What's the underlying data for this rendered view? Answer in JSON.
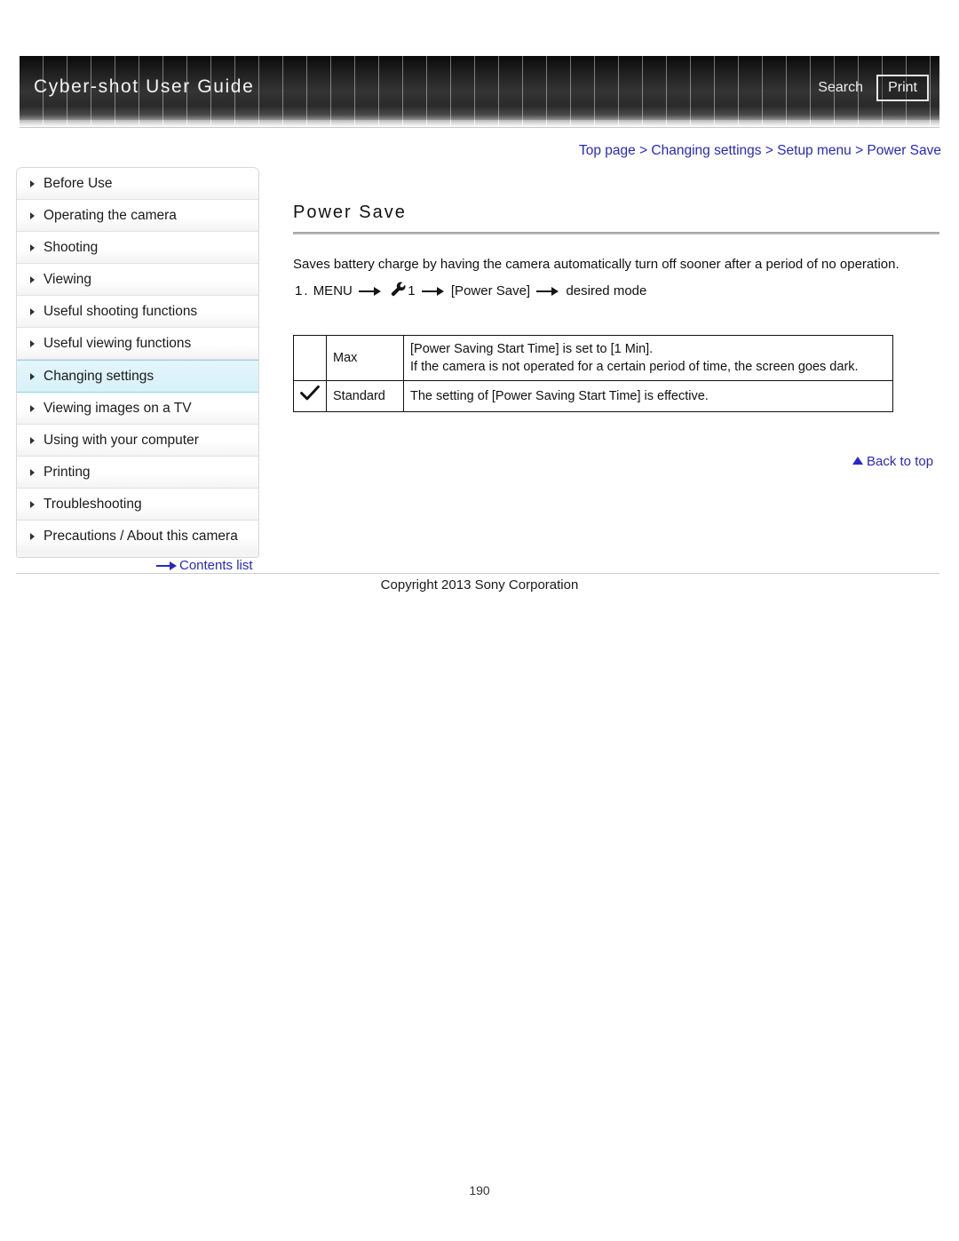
{
  "header": {
    "site_title": "Cyber-shot User Guide",
    "search_label": "Search",
    "print_label": "Print"
  },
  "breadcrumb": {
    "text": "Top page > Changing settings > Setup menu > Power Save",
    "items": [
      "Top page",
      "Changing settings",
      "Setup menu",
      "Power Save"
    ],
    "separator": ">",
    "link_color": "#2828c8"
  },
  "sidebar": {
    "items": [
      {
        "label": "Before Use",
        "active": false
      },
      {
        "label": "Operating the camera",
        "active": false
      },
      {
        "label": "Shooting",
        "active": false
      },
      {
        "label": "Viewing",
        "active": false
      },
      {
        "label": "Useful shooting functions",
        "active": false
      },
      {
        "label": "Useful viewing functions",
        "active": false
      },
      {
        "label": "Changing settings",
        "active": true
      },
      {
        "label": "Viewing images on a TV",
        "active": false
      },
      {
        "label": "Using with your computer",
        "active": false
      },
      {
        "label": "Printing",
        "active": false
      },
      {
        "label": "Troubleshooting",
        "active": false
      },
      {
        "label": "Precautions / About this camera",
        "active": false
      }
    ],
    "active_label": "Changing settings",
    "active_bg": "#ddf3fa",
    "contents_link": "Contents list"
  },
  "main": {
    "title": "Power Save",
    "intro": "Saves battery charge by having the camera automatically turn off sooner after a period of no operation.",
    "step": {
      "number": "1.",
      "part1": "MENU",
      "icon": "wrench-icon",
      "menu_tab": "1",
      "part2": "[Power Save]",
      "part3": "desired mode"
    },
    "table": {
      "rows": [
        {
          "checked": false,
          "name": "Max",
          "desc_line1": "[Power Saving Start Time] is set to [1 Min].",
          "desc_line2": "If the camera is not operated for a certain period of time, the screen goes dark."
        },
        {
          "checked": true,
          "name": "Standard",
          "desc_line1": "The setting of [Power Saving Start Time] is effective.",
          "desc_line2": ""
        }
      ]
    },
    "back_to_top": "Back to top"
  },
  "footer": {
    "copyright": "Copyright 2013 Sony Corporation",
    "page_number": "190"
  }
}
